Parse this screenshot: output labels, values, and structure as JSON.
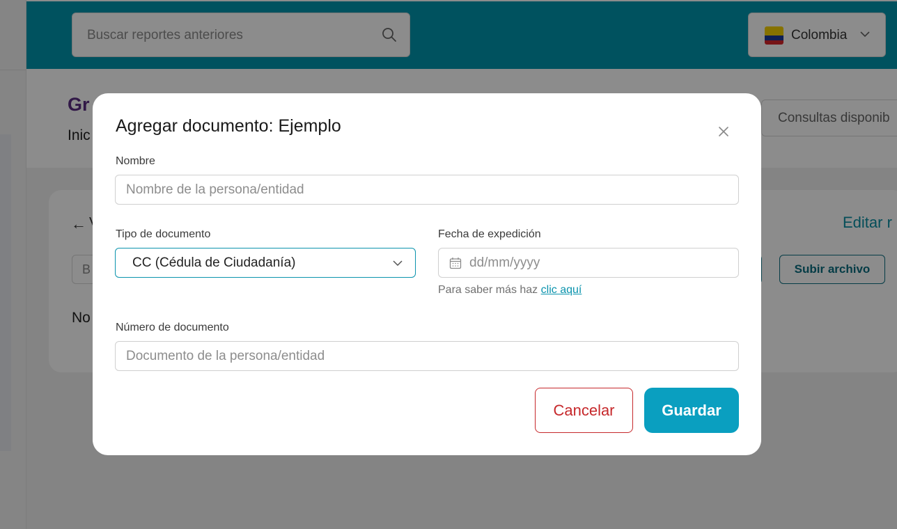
{
  "search": {
    "placeholder": "Buscar reportes anteriores",
    "icon": "search-icon"
  },
  "country_selector": {
    "value": "Colombia",
    "flag": "colombia-flag-icon"
  },
  "page": {
    "heading_fragment": "Gr",
    "breadcrumb_fragment": "Inic",
    "queries_label": "Consultas disponib",
    "back_fragment": "V",
    "edit_link": "Editar r",
    "input_fragment": "B",
    "upload_button": "Subir archivo",
    "empty_fragment": "No"
  },
  "modal": {
    "title": "Agregar documento: Ejemplo",
    "name_label": "Nombre",
    "name_placeholder": "Nombre de la persona/entidad",
    "doc_type_label": "Tipo de documento",
    "doc_type_value": "CC (Cédula de Ciudadanía)",
    "issue_date_label": "Fecha de expedición",
    "issue_date_placeholder": "dd/mm/yyyy",
    "help_text": "Para saber más haz",
    "help_link": "clic aquí",
    "doc_number_label": "Número de documento",
    "doc_number_placeholder": "Documento de la persona/entidad",
    "cancel_label": "Cancelar",
    "save_label": "Guardar"
  },
  "colors": {
    "topbar": "#0096ae",
    "accent": "#0a9fc0",
    "danger": "#c6282b",
    "brand_purple": "#5a2d82"
  }
}
